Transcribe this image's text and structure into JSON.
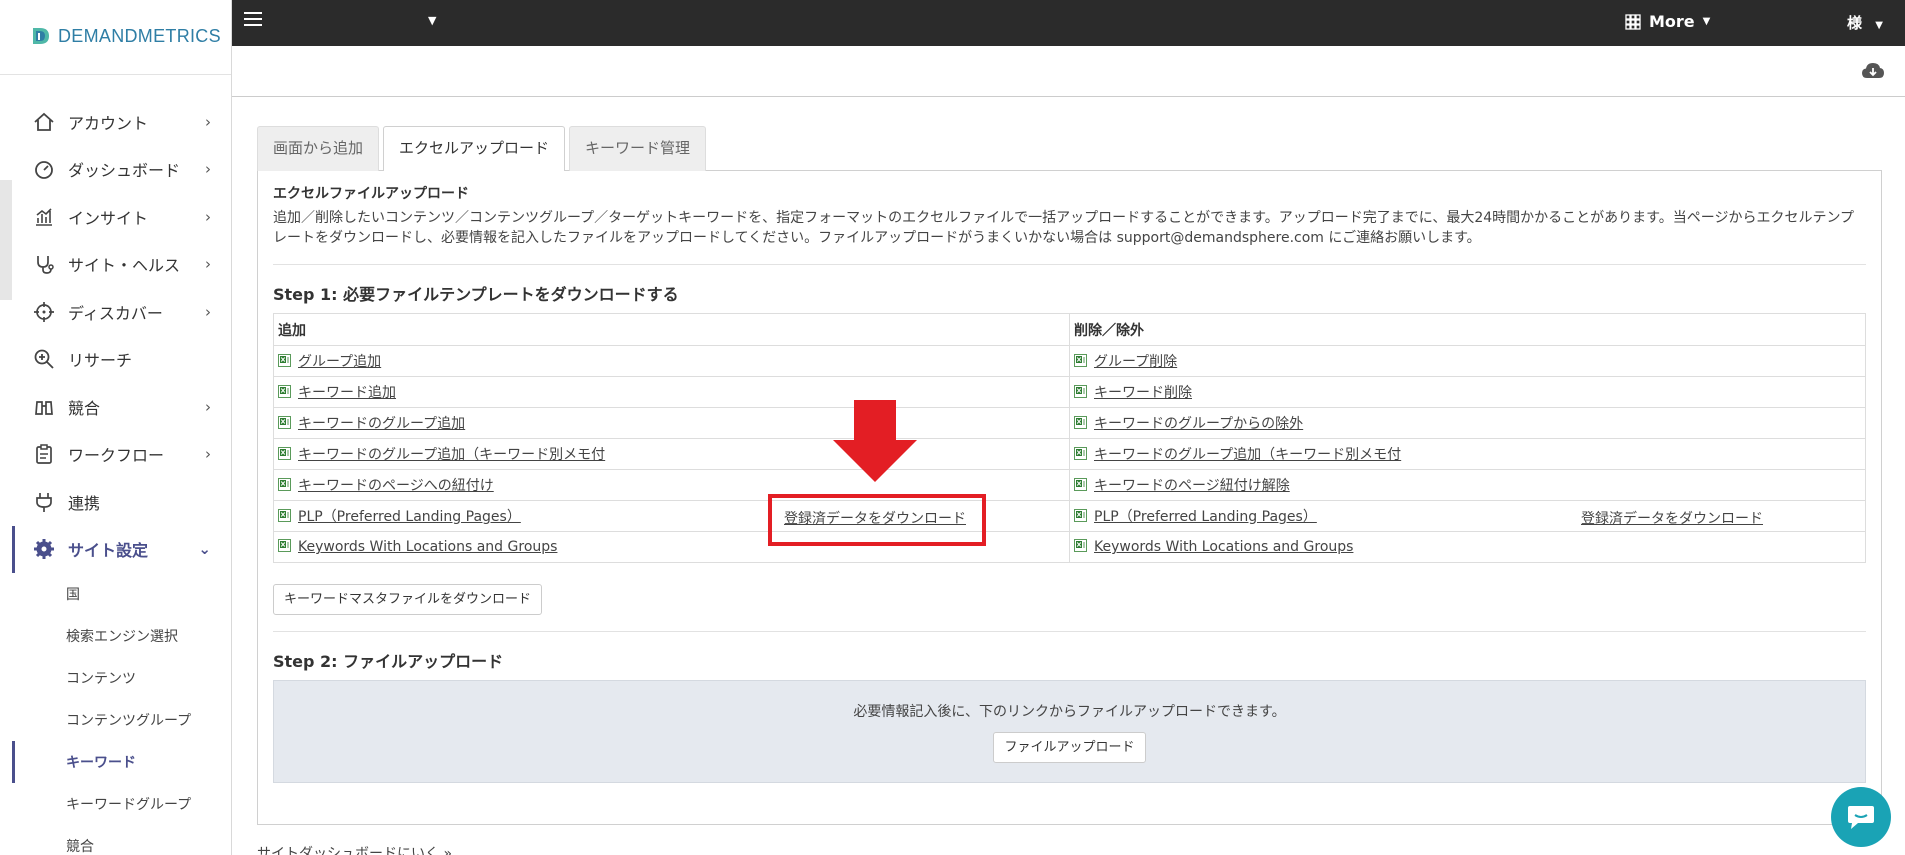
{
  "brand": {
    "name": "DEMANDMETRICS"
  },
  "topbar": {
    "more_label": "More",
    "user_label": "様"
  },
  "sidebar": {
    "items": [
      {
        "label": "アカウント",
        "icon": "home-icon",
        "has_chevron": true
      },
      {
        "label": "ダッシュボード",
        "icon": "gauge-icon",
        "has_chevron": true
      },
      {
        "label": "インサイト",
        "icon": "chart-icon",
        "has_chevron": true
      },
      {
        "label": "サイト・ヘルス",
        "icon": "stethoscope-icon",
        "has_chevron": true
      },
      {
        "label": "ディスカバー",
        "icon": "crosshair-icon",
        "has_chevron": true
      },
      {
        "label": "リサーチ",
        "icon": "search-plus-icon",
        "has_chevron": false
      },
      {
        "label": "競合",
        "icon": "binoculars-icon",
        "has_chevron": true
      },
      {
        "label": "ワークフロー",
        "icon": "clipboard-icon",
        "has_chevron": true
      },
      {
        "label": "連携",
        "icon": "plug-icon",
        "has_chevron": false
      },
      {
        "label": "サイト設定",
        "icon": "gear-icon",
        "has_chevron": true,
        "active": true
      }
    ],
    "sub_items": [
      {
        "label": "国"
      },
      {
        "label": "検索エンジン選択"
      },
      {
        "label": "コンテンツ"
      },
      {
        "label": "コンテンツグループ"
      },
      {
        "label": "キーワード",
        "active": true
      },
      {
        "label": "キーワードグループ"
      },
      {
        "label": "競合"
      }
    ]
  },
  "tabs": [
    {
      "label": "画面から追加"
    },
    {
      "label": "エクセルアップロード",
      "active": true
    },
    {
      "label": "キーワード管理"
    }
  ],
  "panel": {
    "heading": "エクセルファイルアップロード",
    "description": "追加／削除したいコンテンツ／コンテンツグループ／ターゲットキーワードを、指定フォーマットのエクセルファイルで一括アップロードすることができます。アップロード完了までに、最大24時間かかることがあります。当ページからエクセルテンプレートをダウンロードし、必要情報を記入したファイルをアップロードしてください。ファイルアップロードがうまくいかない場合は support@demandsphere.com にご連絡お願いします。",
    "step1_title": "Step 1: 必要ファイルテンプレートをダウンロードする",
    "table": {
      "headers": [
        "追加",
        "削除／除外"
      ],
      "rows": [
        [
          "グループ追加",
          "グループ削除"
        ],
        [
          "キーワード追加",
          "キーワード削除"
        ],
        [
          "キーワードのグループ追加",
          "キーワードのグループからの除外"
        ],
        [
          "キーワードのグループ追加（キーワード別メモ付",
          "キーワードのグループ追加（キーワード別メモ付"
        ],
        [
          "キーワードのページへの紐付け",
          "キーワードのページ紐付け解除"
        ],
        [
          "PLP（Preferred Landing Pages）",
          "PLP（Preferred Landing Pages）"
        ],
        [
          "Keywords With Locations and Groups",
          "Keywords With Locations and Groups"
        ]
      ],
      "download_registered_label": "登録済データをダウンロード"
    },
    "master_button": "キーワードマスタファイルをダウンロード",
    "step2_title": "Step 2: ファイルアップロード",
    "upload_note": "必要情報記入後に、下のリンクからファイルアップロードできます。",
    "upload_button": "ファイルアップロード"
  },
  "footer_link": "サイトダッシュボードにいく »",
  "colors": {
    "accent": "#4a4f8c",
    "highlight": "#e31e24",
    "topbar": "#2b2b2b",
    "chat": "#1aa3b5"
  }
}
